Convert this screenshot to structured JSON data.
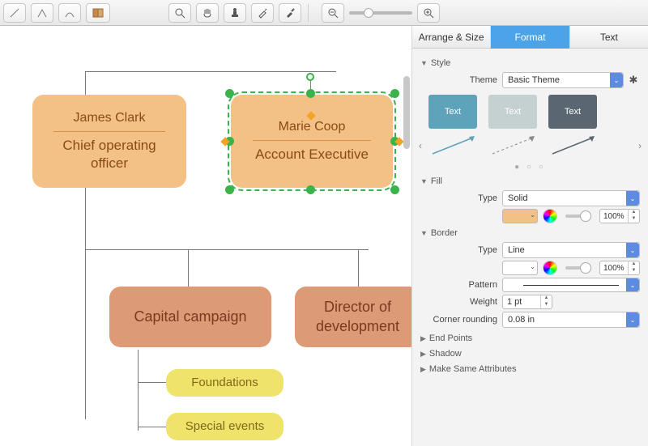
{
  "toolbar": {
    "icons": [
      "line-tool",
      "pen-tool",
      "connector-tool",
      "page-frame",
      "zoom",
      "pan",
      "stamp",
      "eyedropper",
      "paint"
    ],
    "zoom_out": "−",
    "zoom_in": "+"
  },
  "nodes": {
    "n1": {
      "name": "James Clark",
      "role": "Chief operating officer"
    },
    "n2": {
      "name": "Marie Coop",
      "role": "Account Executive"
    },
    "n3": {
      "label": "Capital campaign"
    },
    "n4": {
      "label": "Director of development"
    },
    "n5": {
      "label": "Foundations"
    },
    "n6": {
      "label": "Special events"
    }
  },
  "panel": {
    "tabs": {
      "arrange": "Arrange & Size",
      "format": "Format",
      "text": "Text"
    },
    "style": {
      "header": "Style",
      "theme_label": "Theme",
      "theme_value": "Basic Theme",
      "thumb_text": "Text"
    },
    "fill": {
      "header": "Fill",
      "type_label": "Type",
      "type_value": "Solid",
      "opacity": "100%"
    },
    "border": {
      "header": "Border",
      "type_label": "Type",
      "type_value": "Line",
      "opacity": "100%",
      "pattern_label": "Pattern",
      "weight_label": "Weight",
      "weight_value": "1 pt",
      "corner_label": "Corner rounding",
      "corner_value": "0.08 in"
    },
    "endpoints": "End Points",
    "shadow": "Shadow",
    "same_attrs": "Make Same Attributes"
  }
}
